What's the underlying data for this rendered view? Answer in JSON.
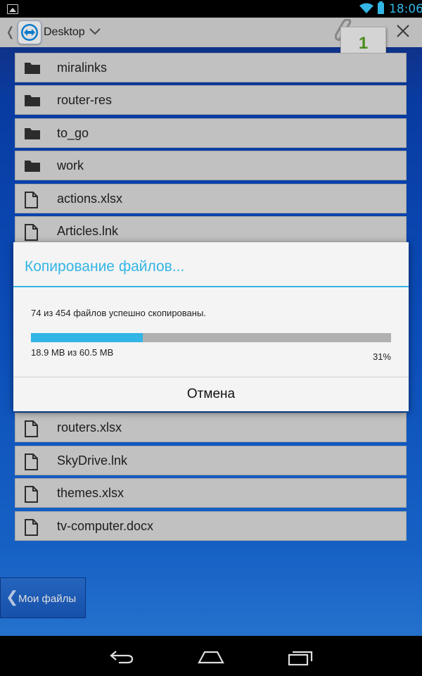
{
  "status_bar": {
    "time": "18:06"
  },
  "header": {
    "title": "Desktop",
    "paste_count": "1"
  },
  "files": [
    {
      "name": "miralinks",
      "type": "folder"
    },
    {
      "name": "router-res",
      "type": "folder"
    },
    {
      "name": "to_go",
      "type": "folder"
    },
    {
      "name": "work",
      "type": "folder"
    },
    {
      "name": "actions.xlsx",
      "type": "file"
    },
    {
      "name": "Articles.lnk",
      "type": "file"
    },
    {
      "name": "routers.xlsx",
      "type": "file"
    },
    {
      "name": "SkyDrive.lnk",
      "type": "file"
    },
    {
      "name": "themes.xlsx",
      "type": "file"
    },
    {
      "name": "tv-computer.docx",
      "type": "file"
    }
  ],
  "dialog": {
    "title": "Копирование файлов...",
    "message": "74 из 454 файлов успешно скопированы.",
    "size_progress": "18.9 MB из 60.5 MB",
    "percent_label": "31%",
    "progress": 0.31,
    "cancel_label": "Отмена"
  },
  "bottom": {
    "my_files_label": "Мои файлы"
  },
  "colors": {
    "accent": "#33b5e5",
    "row_bg": "#dcdcdc",
    "paste_count_color": "#57a020"
  }
}
